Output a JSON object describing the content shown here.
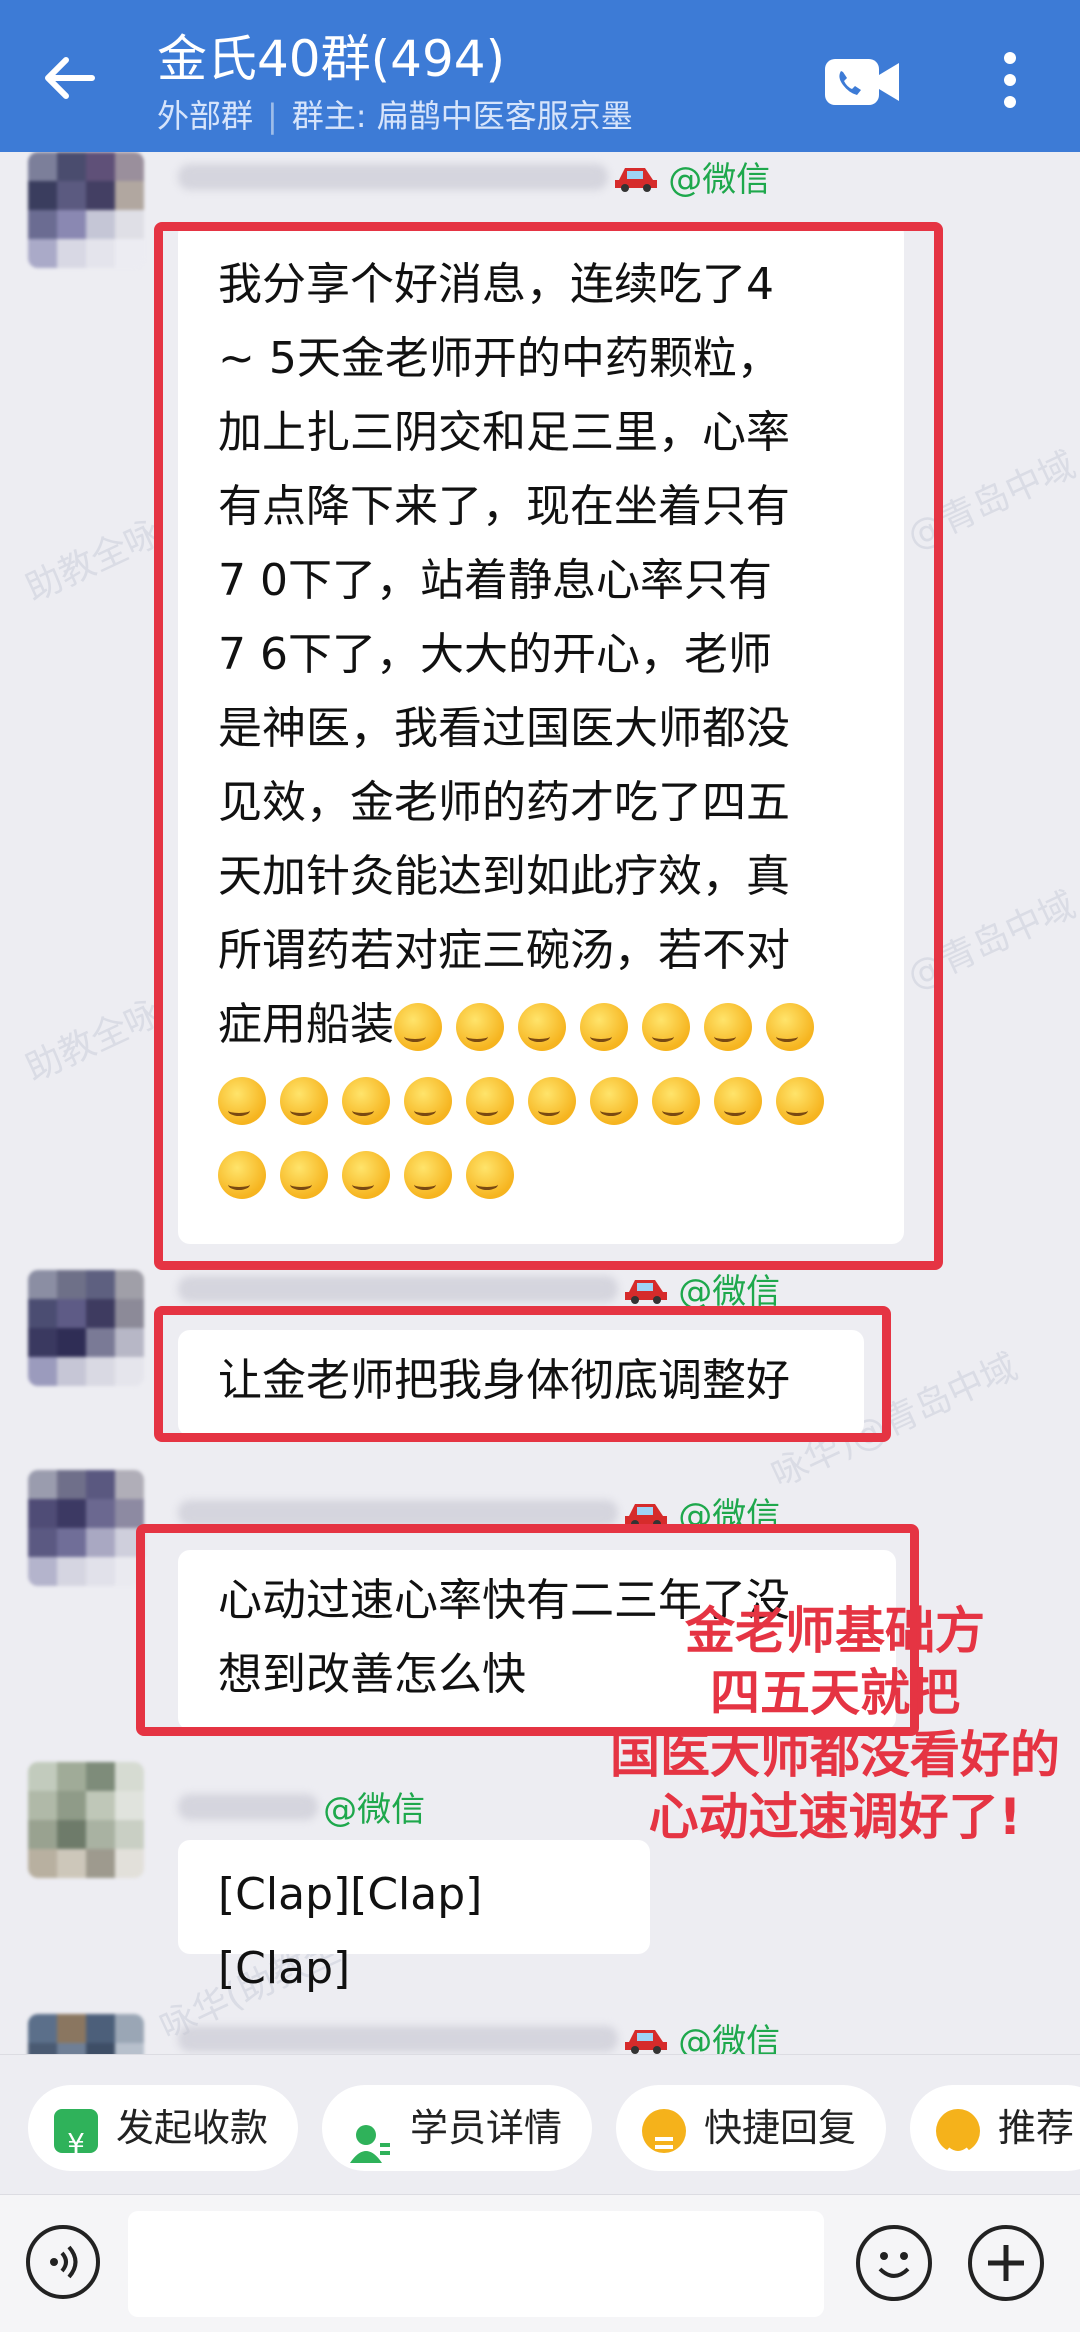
{
  "header": {
    "title": "金氏40群(494)",
    "group_type": "外部群",
    "owner": "群主: 扁鹊中医客服京墨"
  },
  "watermarks": [
    "助教全咏",
    "@青岛中域",
    "助教全咏",
    "@青岛中域",
    "咏华)@青岛中域",
    "咏华(助教全咏"
  ],
  "messages": [
    {
      "sender_tag": "@微信",
      "lines": [
        "我分享个好消息，连续吃了4",
        "~ 5天金老师开的中药颗粒，",
        "加上扎三阴交和足三里，心率",
        "有点降下来了，现在坐着只有",
        "7 0下了，站着静息心率只有",
        "7 6下了，大大的开心，老师",
        "是神医，我看过国医大师都没",
        "见效，金老师的药才吃了四五",
        "天加针灸能达到如此疗效，真",
        "所谓药若对症三碗汤，若不对",
        "症用船装"
      ],
      "emoji": "thinking-face"
    },
    {
      "sender_tag": "@微信",
      "lines": [
        "让金老师把我身体彻底调整好"
      ]
    },
    {
      "sender_tag": "@微信",
      "lines": [
        "心动过速心率快有二三年了没",
        "想到改善怎么快"
      ]
    },
    {
      "sender_tag": "@微信",
      "lines": [
        "[Clap][Clap][Clap]"
      ]
    },
    {
      "sender_tag": "@微信"
    }
  ],
  "annotation": [
    "金老师基础方",
    "四五天就把",
    "国医大师都没看好的",
    "心动过速调好了!"
  ],
  "quick_actions": [
    {
      "label": "发起收款",
      "color": "#2fb25a"
    },
    {
      "label": "学员详情",
      "color": "#2fb25a"
    },
    {
      "label": "快捷回复",
      "color": "#f5b21b"
    },
    {
      "label": "推荐",
      "color": "#f5b21b"
    }
  ],
  "colors": {
    "header": "#3d7bd6",
    "highlight": "#e53443",
    "wechat_tag": "#1ea84c"
  }
}
